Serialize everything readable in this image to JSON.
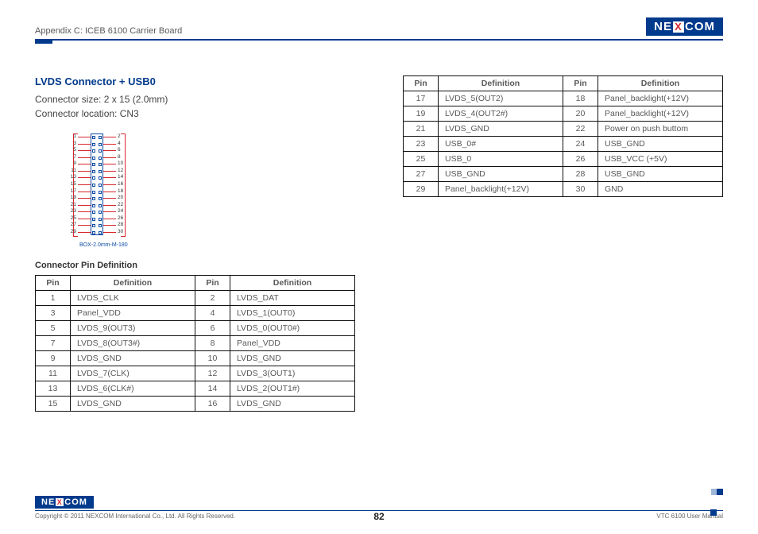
{
  "header": {
    "appendix": "Appendix C: ICEB 6100 Carrier Board",
    "logo_left": "NE",
    "logo_x": "X",
    "logo_right": "COM"
  },
  "section": {
    "title": "LVDS Connector + USB0",
    "size_label": "Connector size:  2 x 15 (2.0mm)",
    "location_label": "Connector location: CN3",
    "diagram_caption": "BOX-2.0mm-M-180",
    "subhead": "Connector Pin Definition"
  },
  "table_headers": {
    "pin": "Pin",
    "definition": "Definition"
  },
  "pins_left": [
    {
      "p1": "1",
      "d1": "LVDS_CLK",
      "p2": "2",
      "d2": "LVDS_DAT"
    },
    {
      "p1": "3",
      "d1": "Panel_VDD",
      "p2": "4",
      "d2": "LVDS_1(OUT0)"
    },
    {
      "p1": "5",
      "d1": "LVDS_9(OUT3)",
      "p2": "6",
      "d2": "LVDS_0(OUT0#)"
    },
    {
      "p1": "7",
      "d1": "LVDS_8(OUT3#)",
      "p2": "8",
      "d2": "Panel_VDD"
    },
    {
      "p1": "9",
      "d1": "LVDS_GND",
      "p2": "10",
      "d2": "LVDS_GND"
    },
    {
      "p1": "11",
      "d1": "LVDS_7(CLK)",
      "p2": "12",
      "d2": "LVDS_3(OUT1)"
    },
    {
      "p1": "13",
      "d1": "LVDS_6(CLK#)",
      "p2": "14",
      "d2": "LVDS_2(OUT1#)"
    },
    {
      "p1": "15",
      "d1": "LVDS_GND",
      "p2": "16",
      "d2": "LVDS_GND"
    }
  ],
  "pins_right": [
    {
      "p1": "17",
      "d1": "LVDS_5(OUT2)",
      "p2": "18",
      "d2": "Panel_backlight(+12V)"
    },
    {
      "p1": "19",
      "d1": "LVDS_4(OUT2#)",
      "p2": "20",
      "d2": "Panel_backlight(+12V)"
    },
    {
      "p1": "21",
      "d1": "LVDS_GND",
      "p2": "22",
      "d2": "Power on push buttom"
    },
    {
      "p1": "23",
      "d1": "USB_0#",
      "p2": "24",
      "d2": "USB_GND"
    },
    {
      "p1": "25",
      "d1": "USB_0",
      "p2": "26",
      "d2": "USB_VCC (+5V)"
    },
    {
      "p1": "27",
      "d1": "USB_GND",
      "p2": "28",
      "d2": "USB_GND"
    },
    {
      "p1": "29",
      "d1": "Panel_backlight(+12V)",
      "p2": "30",
      "d2": "GND"
    }
  ],
  "footer": {
    "copyright": "Copyright © 2011 NEXCOM International Co., Ltd. All Rights Reserved.",
    "page": "82",
    "manual": "VTC 6100 User Manual"
  }
}
